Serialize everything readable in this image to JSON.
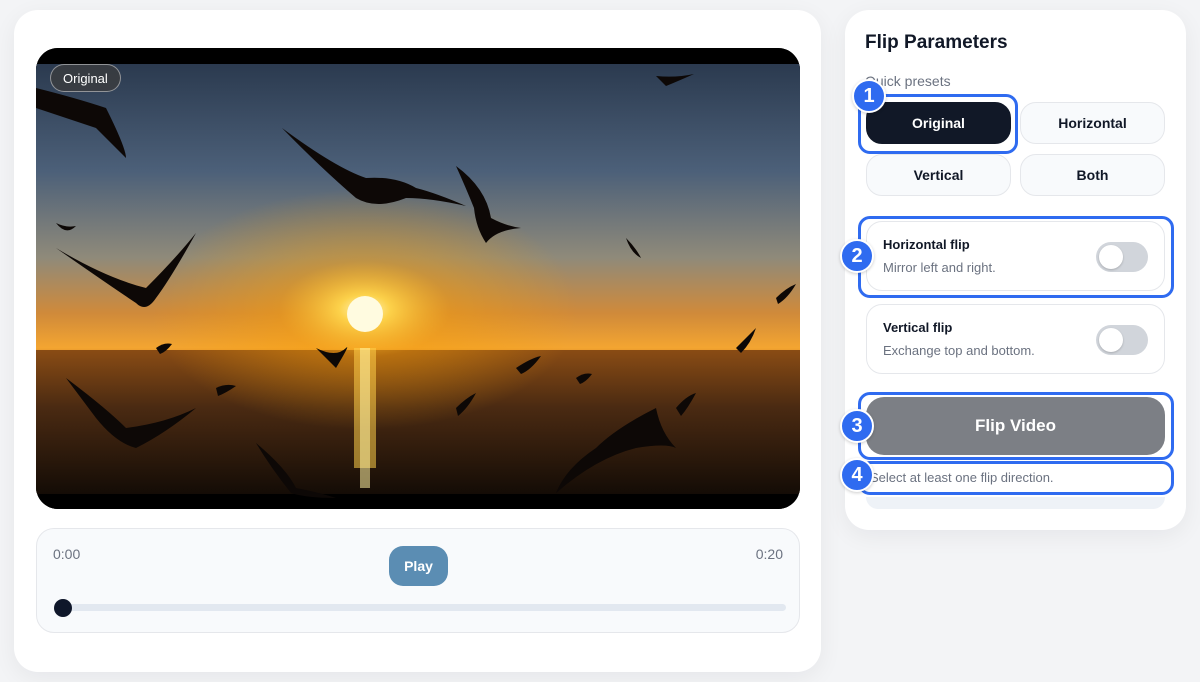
{
  "video": {
    "badge": "Original"
  },
  "player": {
    "current_time": "0:00",
    "duration": "0:20",
    "play_label": "Play",
    "progress": 0
  },
  "panel": {
    "title": "Flip Parameters",
    "presets_label": "Quick presets",
    "presets": [
      {
        "label": "Original",
        "active": true
      },
      {
        "label": "Horizontal",
        "active": false
      },
      {
        "label": "Vertical",
        "active": false
      },
      {
        "label": "Both",
        "active": false
      }
    ],
    "horizontal_flip": {
      "title": "Horizontal flip",
      "description": "Mirror left and right.",
      "enabled": false
    },
    "vertical_flip": {
      "title": "Vertical flip",
      "description": "Exchange top and bottom.",
      "enabled": false
    },
    "flip_button": "Flip Video",
    "hint": "Select at least one flip direction."
  },
  "callouts": [
    "1",
    "2",
    "3",
    "4"
  ],
  "colors": {
    "accent": "#2f6bf0",
    "play": "#5b8db3",
    "active_preset": "#111827",
    "disabled_button": "#7c7f85"
  }
}
